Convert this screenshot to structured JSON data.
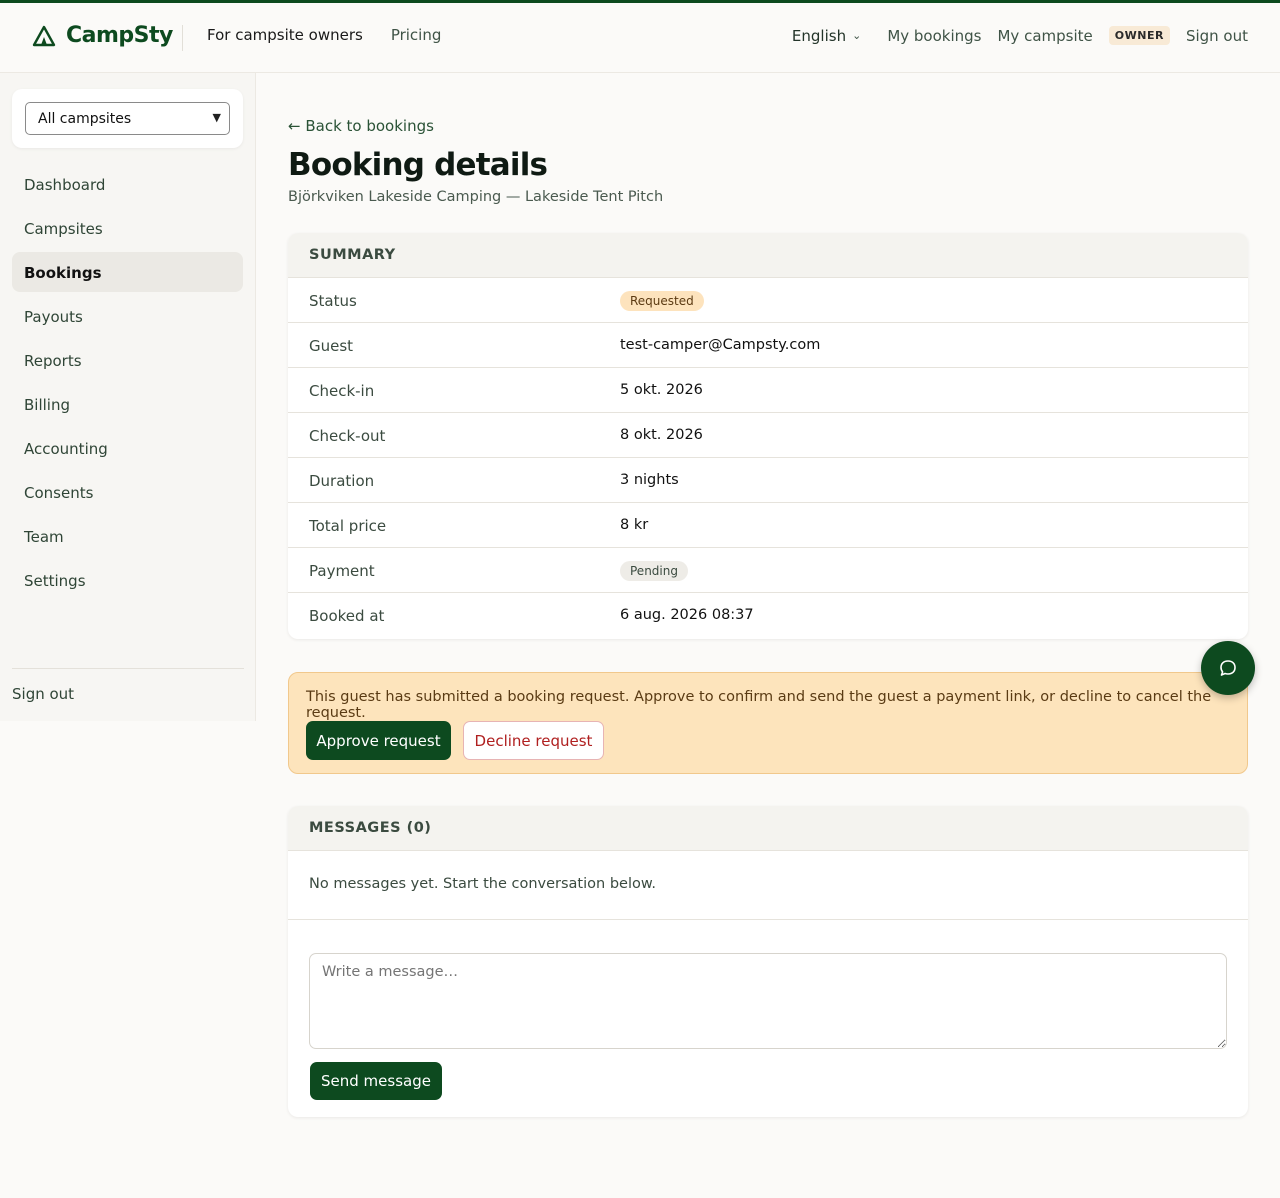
{
  "header": {
    "brand": "CampSty",
    "nav_left": {
      "owners": "For campsite owners",
      "pricing": "Pricing"
    },
    "language": "English",
    "my_bookings": "My bookings",
    "my_campsite": "My campsite",
    "role_badge": "OWNER",
    "sign_out": "Sign out"
  },
  "sidebar": {
    "campsite_select": "All campsites",
    "items": [
      {
        "label": "Dashboard"
      },
      {
        "label": "Campsites"
      },
      {
        "label": "Bookings",
        "active": true
      },
      {
        "label": "Payouts"
      },
      {
        "label": "Reports"
      },
      {
        "label": "Billing"
      },
      {
        "label": "Accounting"
      },
      {
        "label": "Consents"
      },
      {
        "label": "Team"
      },
      {
        "label": "Settings"
      }
    ],
    "sign_out": "Sign out"
  },
  "main": {
    "back_link": "← Back to bookings",
    "title": "Booking details",
    "subtitle": "Björkviken Lakeside Camping — Lakeside Tent Pitch",
    "summary": {
      "heading": "SUMMARY",
      "status_label": "Status",
      "status_value": "Requested",
      "guest_label": "Guest",
      "guest_value": "test-camper@Campsty.com",
      "checkin_label": "Check-in",
      "checkin_value": "5 okt. 2026",
      "checkout_label": "Check-out",
      "checkout_value": "8 okt. 2026",
      "duration_label": "Duration",
      "duration_value": "3 nights",
      "price_label": "Total price",
      "price_value": "8 kr",
      "payment_label": "Payment",
      "payment_value": "Pending",
      "booked_label": "Booked at",
      "booked_value": "6 aug. 2026 08:37"
    },
    "alert": {
      "text": "This guest has submitted a booking request. Approve to confirm and send the guest a payment link, or decline to cancel the request.",
      "approve": "Approve request",
      "decline": "Decline request"
    },
    "messages": {
      "heading": "MESSAGES (0)",
      "empty": "No messages yet. Start the conversation below.",
      "placeholder": "Write a message…",
      "send": "Send message"
    }
  },
  "colors": {
    "brand_green": "#0d4a1f",
    "requested_badge": "#fde3bd",
    "alert_bg": "#fde4bc",
    "decline_red": "#b02020"
  },
  "icons": {
    "logo": "tent-icon",
    "language_chevron": "chevron-down-icon",
    "chat": "chat-bubble-icon"
  }
}
